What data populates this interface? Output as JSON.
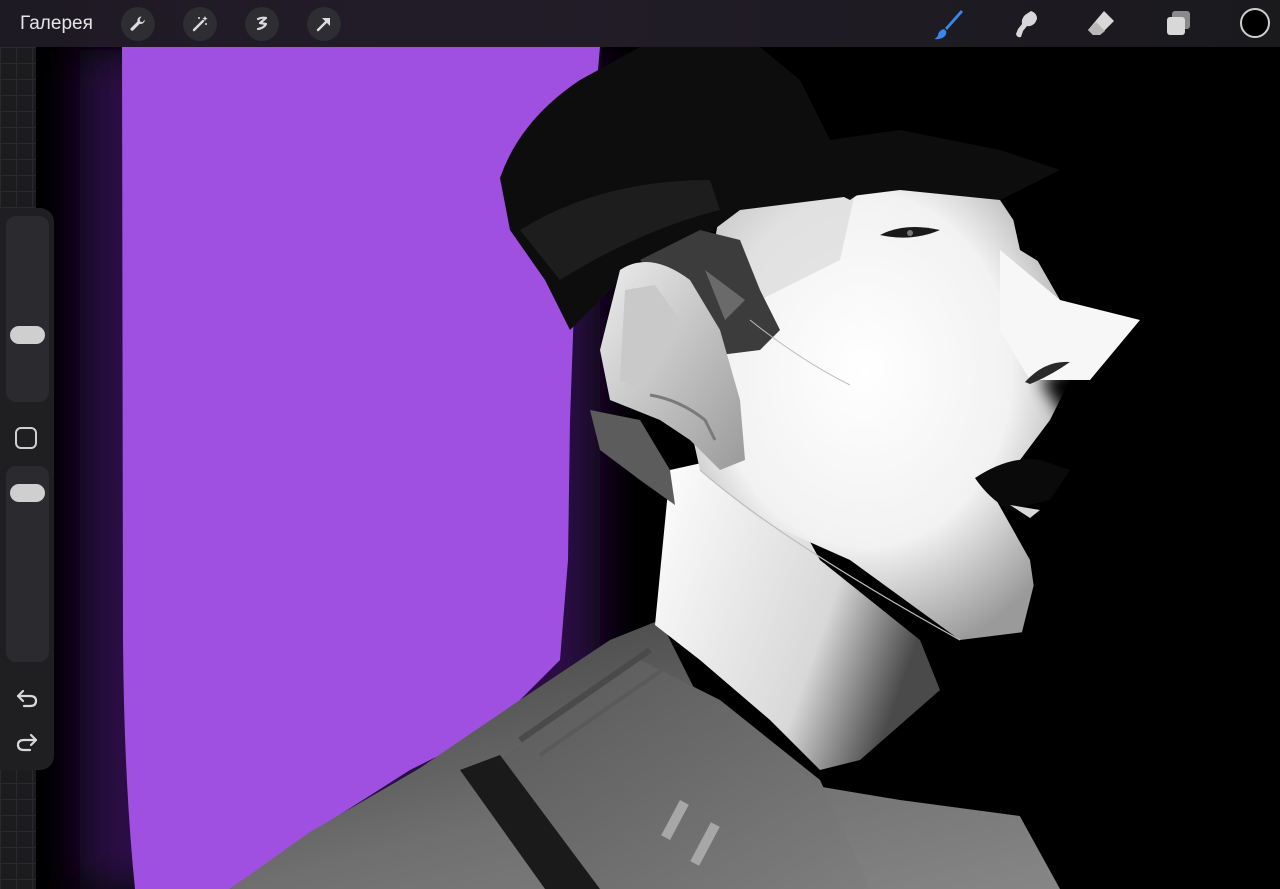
{
  "topbar": {
    "gallery_label": "Галерея",
    "left_tools": [
      "wrench-icon",
      "magic-wand-icon",
      "selection-icon",
      "transform-arrow-icon"
    ],
    "right_tools": [
      "brush-icon",
      "smudge-icon",
      "eraser-icon",
      "layers-icon"
    ],
    "active_tool": "brush-icon",
    "active_color": "#000000",
    "accent_color": "#3a86f0"
  },
  "sidebar": {
    "brush_size_slider": "slider",
    "modify_button": "square-icon",
    "opacity_slider": "slider",
    "undo": "undo-icon",
    "redo": "redo-icon"
  },
  "canvas": {
    "background_color": "#a050e0"
  }
}
